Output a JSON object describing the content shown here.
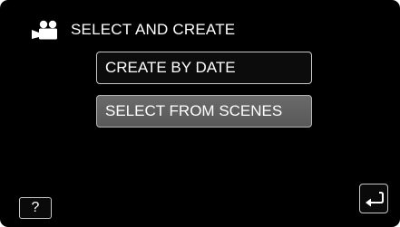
{
  "header": {
    "mode_icon": "video-camera-icon",
    "title": "SELECT AND CREATE"
  },
  "menu": {
    "items": [
      {
        "label": "CREATE BY DATE",
        "highlighted": false
      },
      {
        "label": "SELECT FROM SCENES",
        "highlighted": true
      }
    ]
  },
  "footer": {
    "help_label": "?",
    "back_icon": "return-arrow-icon"
  },
  "colors": {
    "background": "#000000",
    "highlight": "#5f5f5f",
    "border": "#c8c8c8",
    "text": "#ffffff"
  }
}
